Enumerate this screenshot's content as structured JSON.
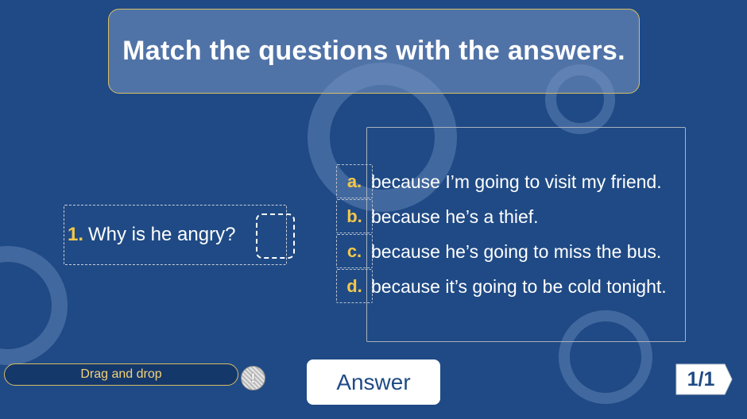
{
  "instruction": {
    "title": "Match the questions with the answers."
  },
  "question": {
    "number": "1.",
    "text": "Why is he angry?"
  },
  "answers": [
    {
      "letter": "a.",
      "text": "because I’m going to visit my friend."
    },
    {
      "letter": "b.",
      "text": "because he’s a thief."
    },
    {
      "letter": "c.",
      "text": "because he’s going to miss the bus."
    },
    {
      "letter": "d.",
      "text": "because it’s going to be cold tonight."
    }
  ],
  "footer": {
    "drag_hint": "Drag and drop",
    "info_icon": "info-icon",
    "answer_label": "Answer",
    "page": "1/1"
  },
  "colors": {
    "background": "#1f4a85",
    "accent_gold": "#f3c74a",
    "title_border": "#d8bd63",
    "text": "#ffffff"
  }
}
